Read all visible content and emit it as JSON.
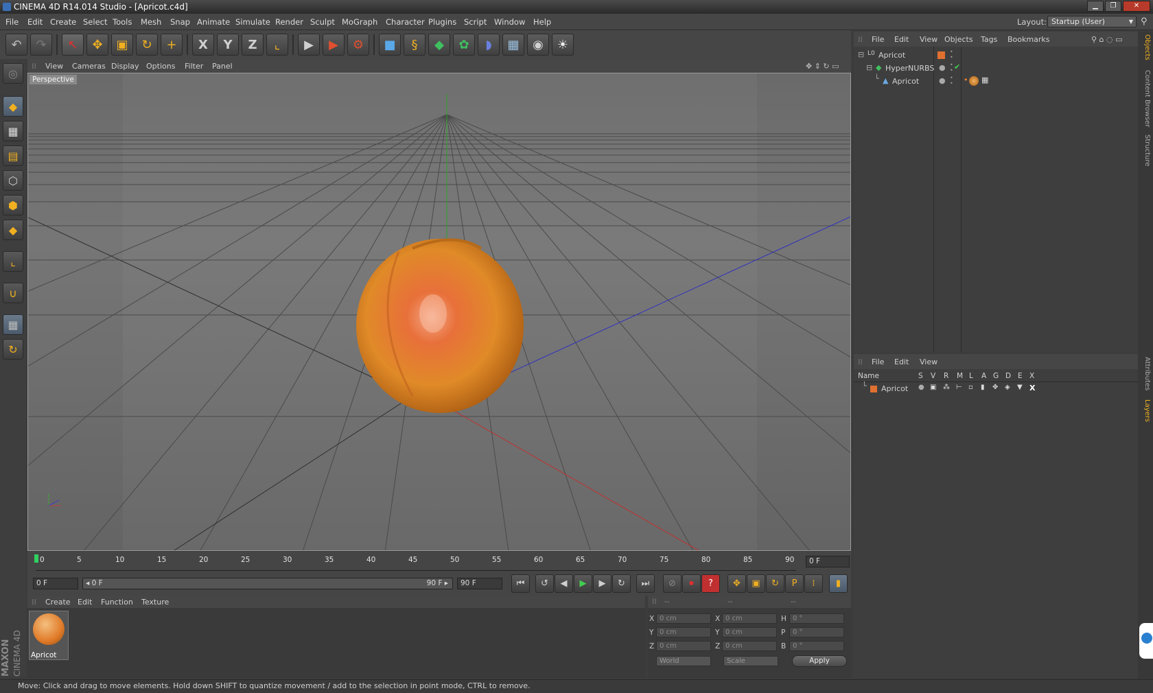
{
  "window": {
    "title": "CINEMA 4D R14.014 Studio - [Apricot.c4d]",
    "minimize": "▁",
    "maximize": "❐",
    "close": "✕"
  },
  "menubar": {
    "items": [
      "File",
      "Edit",
      "Create",
      "Select",
      "Tools",
      "Mesh",
      "Snap",
      "Animate",
      "Simulate",
      "Render",
      "Sculpt",
      "MoGraph",
      "Character",
      "Plugins",
      "Script",
      "Window",
      "Help"
    ],
    "layout_label": "Layout:",
    "layout_value": "Startup (User)"
  },
  "toolbar": {
    "undo": "↶",
    "redo": "↷",
    "select": "↖",
    "move": "✥",
    "scale": "▣",
    "rotate": "↻",
    "add": "+",
    "axis_x": "X",
    "axis_y": "Y",
    "axis_z": "Z",
    "coord": "⌞",
    "render_view": "▶",
    "render_region": "▶",
    "render_settings": "⚙",
    "cube": "■",
    "spline": "§",
    "nurbs": "◆",
    "array": "✿",
    "deformer": "◗",
    "floor": "▦",
    "camera": "◉",
    "light": "☀"
  },
  "viewport_menu": {
    "items": [
      "View",
      "Cameras",
      "Display",
      "Options",
      "Filter",
      "Panel"
    ],
    "label": "Perspective"
  },
  "timeline": {
    "ticks": [
      "0",
      "5",
      "10",
      "15",
      "20",
      "25",
      "30",
      "35",
      "40",
      "45",
      "50",
      "55",
      "60",
      "65",
      "70",
      "75",
      "80",
      "85",
      "90"
    ],
    "current_frame": "0 F",
    "start_field": "0 F",
    "range_start": "◂ 0 F",
    "range_end": "90 F ▸",
    "end_field": "90 F"
  },
  "transport": {
    "first": "⏮",
    "prev_key": "↺",
    "prev": "◀",
    "play": "▶",
    "next": "▶",
    "next_key": "↻",
    "last": "⏭",
    "autokey_off": "⊘",
    "record": "⏺",
    "help": "?",
    "move": "✥",
    "scale": "▣",
    "rotate": "↻",
    "param": "P",
    "dots": "⁞",
    "film": "▮"
  },
  "material_manager": {
    "menu": [
      "Create",
      "Edit",
      "Function",
      "Texture"
    ],
    "materials": [
      {
        "name": "Apricot"
      }
    ]
  },
  "coordinates": {
    "header": [
      "--",
      "--",
      "--"
    ],
    "rows": [
      {
        "l1": "X",
        "v1": "0 cm",
        "l2": "X",
        "v2": "0 cm",
        "l3": "H",
        "v3": "0 °"
      },
      {
        "l1": "Y",
        "v1": "0 cm",
        "l2": "Y",
        "v2": "0 cm",
        "l3": "P",
        "v3": "0 °"
      },
      {
        "l1": "Z",
        "v1": "0 cm",
        "l2": "Z",
        "v2": "0 cm",
        "l3": "B",
        "v3": "0 °"
      }
    ],
    "world": "World",
    "scale": "Scale",
    "apply": "Apply"
  },
  "object_manager": {
    "menu": [
      "File",
      "Edit",
      "View",
      "Objects",
      "Tags",
      "Bookmarks"
    ],
    "objects": [
      {
        "name": "Apricot",
        "prefix": "L0"
      },
      {
        "name": "HyperNURBS"
      },
      {
        "name": "Apricot"
      }
    ]
  },
  "layer_manager": {
    "menu": [
      "File",
      "Edit",
      "View"
    ],
    "columns": [
      "Name",
      "S",
      "V",
      "R",
      "M",
      "L",
      "A",
      "G",
      "D",
      "E",
      "X"
    ],
    "layers": [
      {
        "name": "Apricot",
        "color": "#e07030"
      }
    ]
  },
  "right_tabs": [
    "Objects",
    "Content Browser",
    "Structure",
    "Attributes",
    "Layers"
  ],
  "brand": {
    "line1": "MAXON",
    "line2": "CINEMA 4D"
  },
  "status": "Move: Click and drag to move elements. Hold down SHIFT to quantize movement / add to the selection in point mode, CTRL to remove.",
  "colors": {
    "accent_orange": "#f0a020",
    "axis_x": "#c03030",
    "axis_y": "#30a030",
    "axis_z": "#3030c0"
  }
}
